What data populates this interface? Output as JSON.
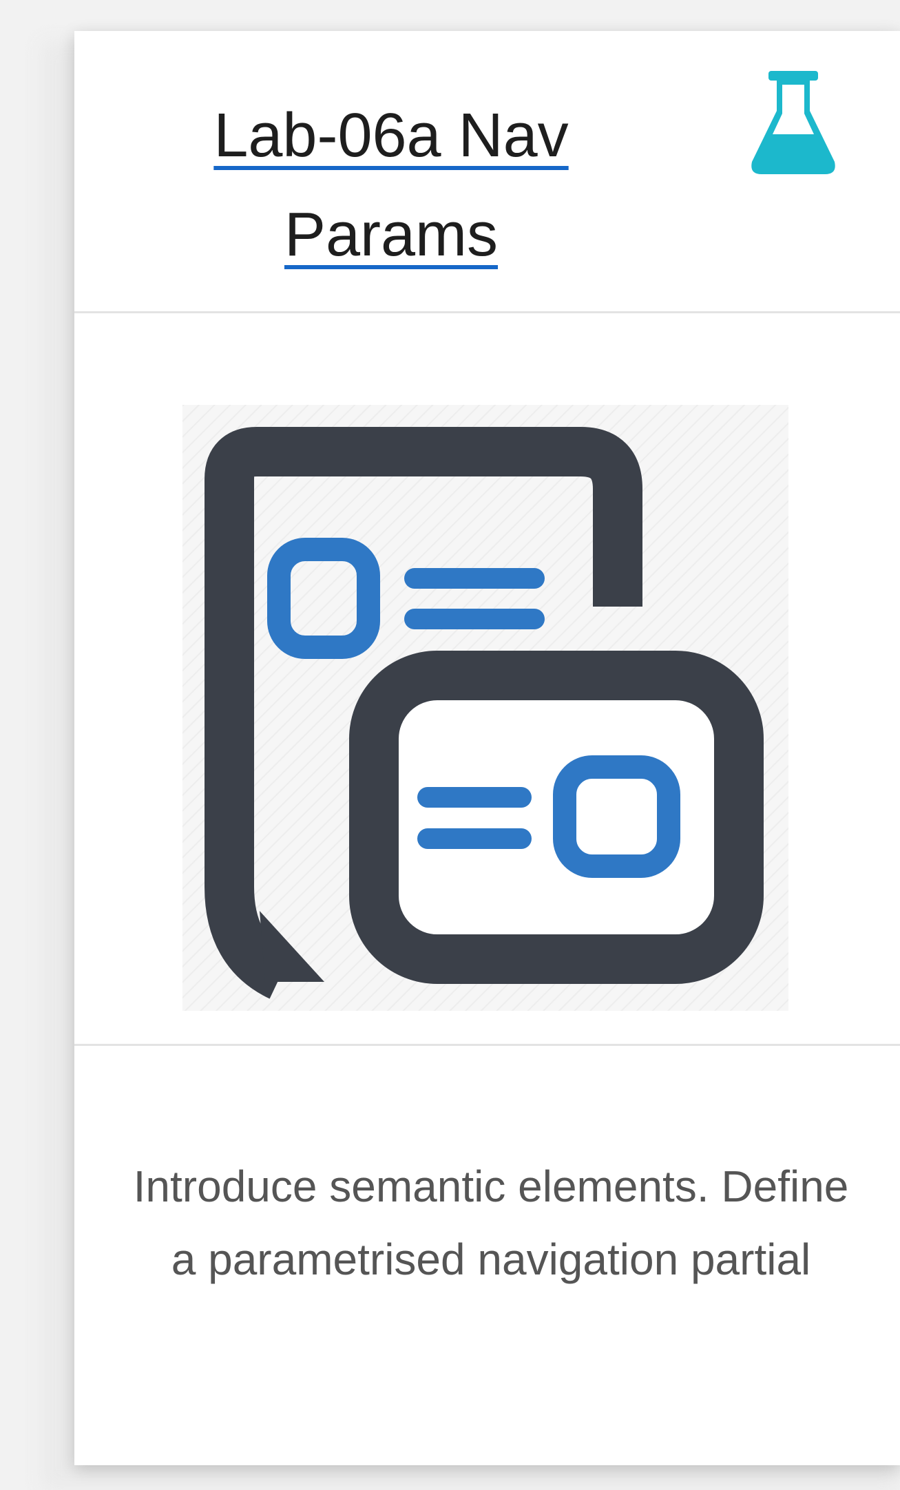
{
  "card": {
    "title": "Lab-06a Nav Params",
    "type_icon": "flask-icon",
    "image_icon": "linked-documents-icon",
    "description": "Introduce semantic elements. Define a parametrised navigation partial"
  },
  "colors": {
    "link_underline": "#1667c8",
    "flask_icon": "#1cb8cc",
    "image_dark": "#3b4049",
    "image_accent": "#2f78c5",
    "description_text": "#555555"
  }
}
